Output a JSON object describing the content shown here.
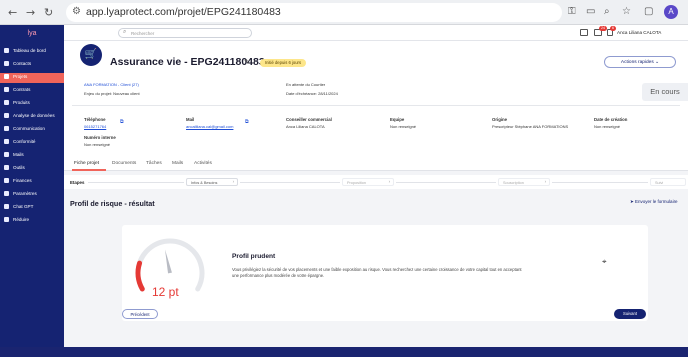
{
  "browser": {
    "url": "app.lyaprotect.com/projet/EPG241180483",
    "profile_initial": "A"
  },
  "sidebar": {
    "logo": "lya",
    "items": [
      {
        "label": "Tableau de bord"
      },
      {
        "label": "Contacts"
      },
      {
        "label": "Projets",
        "active": true
      },
      {
        "label": "Contrats"
      },
      {
        "label": "Produits"
      },
      {
        "label": "Analyse de données"
      },
      {
        "label": "Communication"
      },
      {
        "label": "Conformité"
      },
      {
        "label": "Mails"
      },
      {
        "label": "Outils"
      },
      {
        "label": "Finances"
      },
      {
        "label": "Paramètres"
      },
      {
        "label": "Chat GPT"
      },
      {
        "label": "Réduire"
      }
    ]
  },
  "topbar": {
    "search_placeholder": "Rechercher",
    "badges": [
      "24",
      "6",
      "NEW"
    ],
    "user_name": "Anca Liliana CALOTA"
  },
  "project": {
    "title": "Assurance vie - EPG241180483",
    "chip": "Initié depuis 6 jours",
    "actions_label": "Actions rapides",
    "status": "En cours",
    "client_line": "ANA FORMATION - Client (27)",
    "enjeu": "Enjeu du projet: Nouveau client",
    "attente": "En attente du Courtier",
    "echeance": "Date d'échéance: 28/11/2024",
    "contact_fields": [
      {
        "head": "Téléphone",
        "value": "0615271764"
      },
      {
        "head": "Mail",
        "value": "ancaliliana.cal@gmail.com"
      },
      {
        "head": "Conseiller commercial",
        "value": "Anca Liliana CALOTA"
      },
      {
        "head": "Equipe",
        "value": "Non renseigné"
      },
      {
        "head": "Origine",
        "value": "Prescripteur Stéphane ANA FORMATIONS"
      },
      {
        "head": "Date de création",
        "value": "Non renseigné"
      }
    ],
    "numero_interne_head": "Numéro interne",
    "numero_interne_value": "Non renseigné"
  },
  "tabs": [
    "Fiche projet",
    "Documents",
    "Tâches",
    "Mails",
    "Activités"
  ],
  "steps": {
    "label": "Etapes",
    "items": [
      "Infos & Besoins",
      "Proposition",
      "Souscription",
      "Suivi"
    ]
  },
  "section": {
    "title": "Profil de risque - résultat",
    "send_label": "Envoyer le formulaire"
  },
  "result": {
    "score_text": "12 pt",
    "score": 12,
    "score_max": 100,
    "profile_title": "Profil prudent",
    "description": "Vous privilégiez la sécurité de vos placements et une faible exposition au risque. Vous recherchez une certaine croissance de votre capital tout en acceptant une performance plus modérée de votre épargne.",
    "prev_label": "Précédent",
    "next_label": "Suivant"
  },
  "colors": {
    "sidebar": "#152372",
    "accent": "#f0645a",
    "gauge_active": "#e53935",
    "gauge_track": "#e5e7eb"
  }
}
